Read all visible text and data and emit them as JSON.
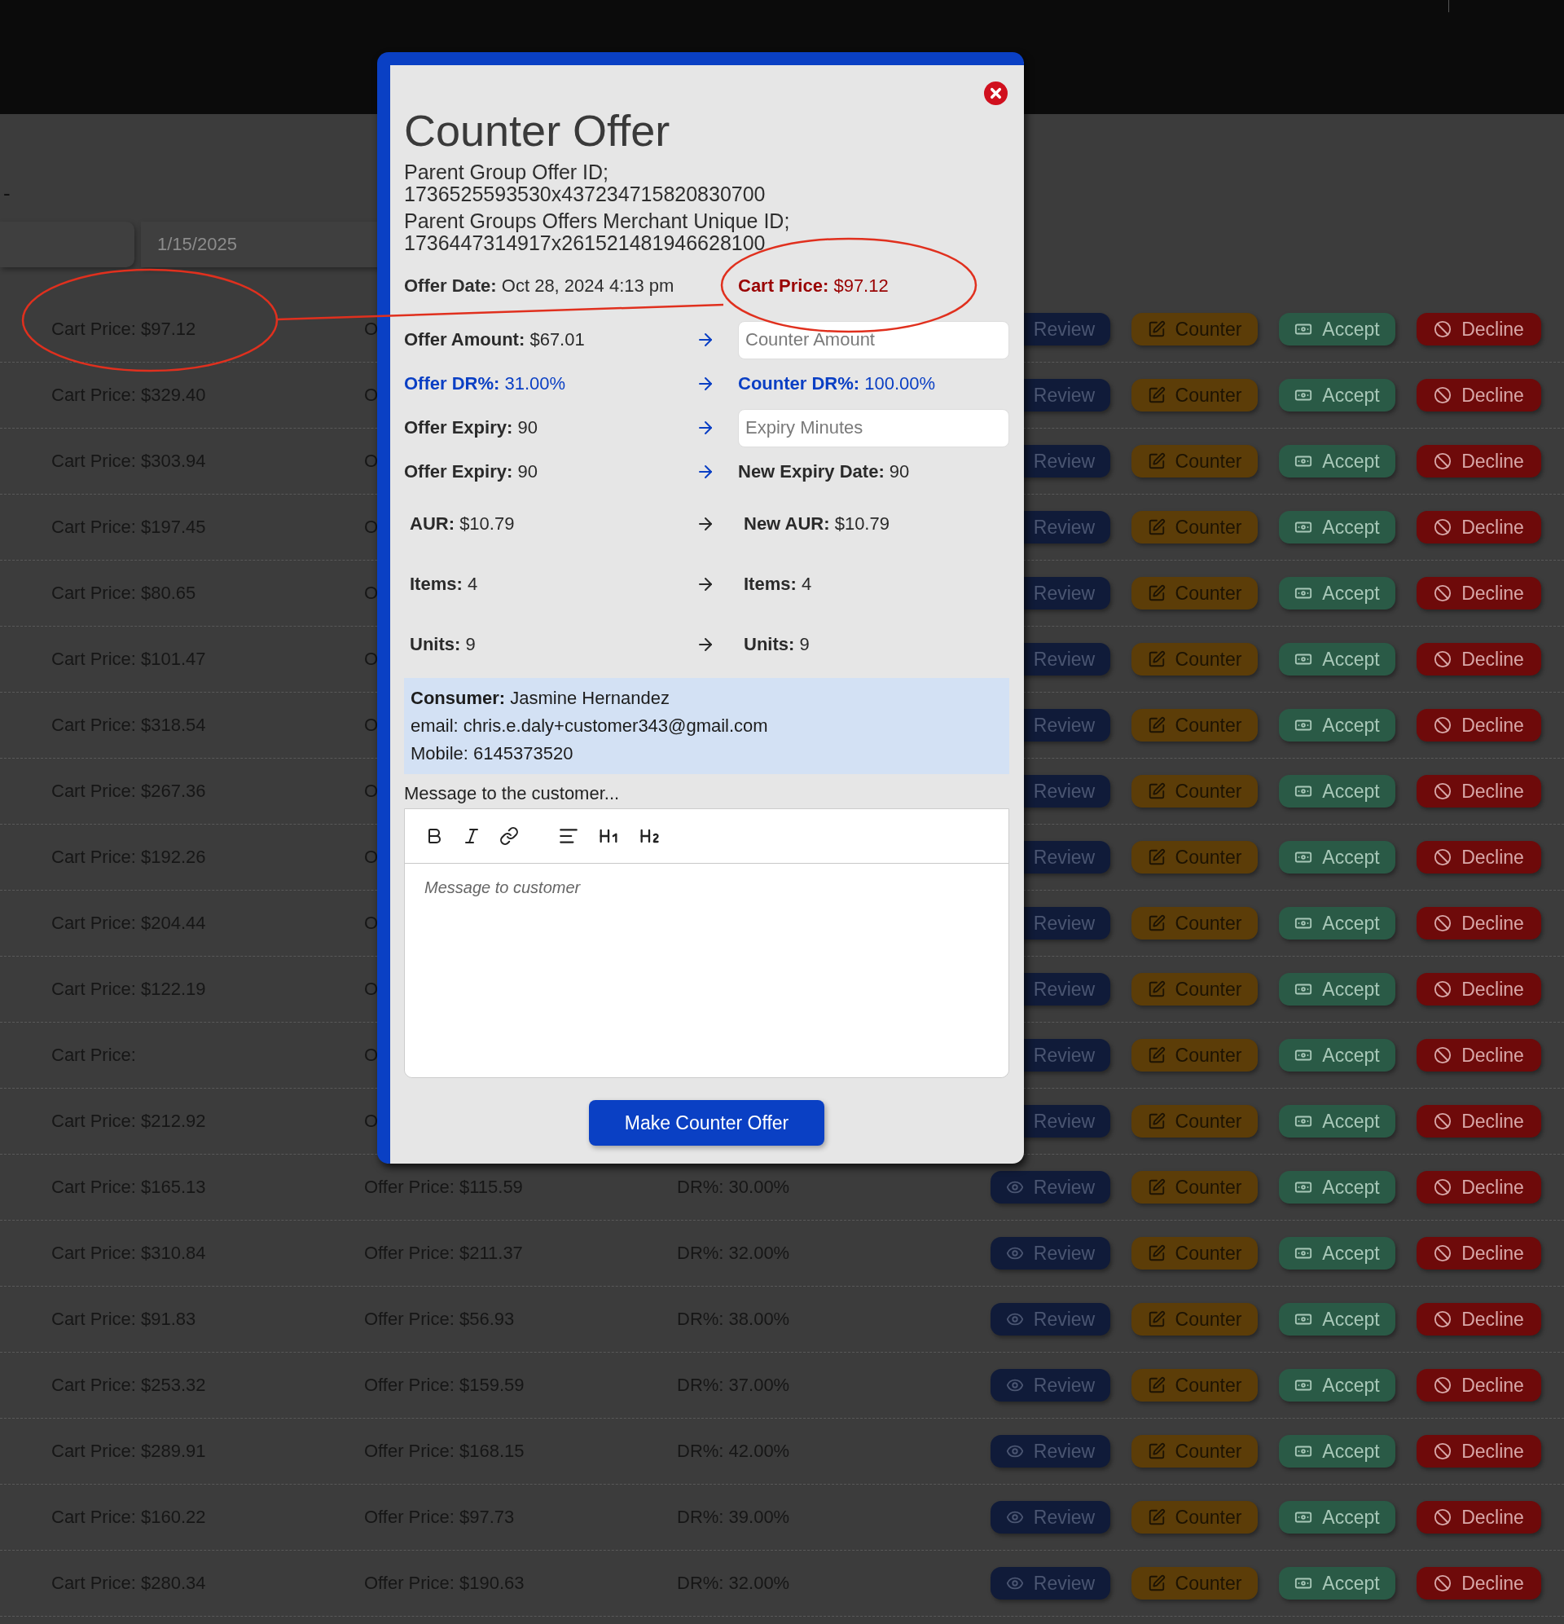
{
  "filters": {
    "separator": "-",
    "end_date": "1/15/2025"
  },
  "rows": [
    {
      "cart_price": "Cart Price: $97.12",
      "offer_price": "O",
      "actions": [
        {
          "kind": "review",
          "label": "Review"
        },
        {
          "kind": "counter",
          "label": "Counter"
        },
        {
          "kind": "accept",
          "label": "Accept"
        },
        {
          "kind": "decline",
          "label": "Decline"
        }
      ]
    },
    {
      "cart_price": "Cart Price: $329.40",
      "offer_price": "O",
      "actions": [
        {
          "kind": "review",
          "label": "Review"
        },
        {
          "kind": "counter",
          "label": "Counter"
        },
        {
          "kind": "accept",
          "label": "Accept"
        },
        {
          "kind": "decline",
          "label": "Decline"
        }
      ]
    },
    {
      "cart_price": "Cart Price: $303.94",
      "offer_price": "O",
      "actions": [
        {
          "kind": "review",
          "label": "Review"
        },
        {
          "kind": "counter",
          "label": "Counter"
        },
        {
          "kind": "accept",
          "label": "Accept"
        },
        {
          "kind": "decline",
          "label": "Decline"
        }
      ]
    },
    {
      "cart_price": "Cart Price: $197.45",
      "offer_price": "O",
      "actions": [
        {
          "kind": "review",
          "label": "Review"
        },
        {
          "kind": "counter",
          "label": "Counter"
        },
        {
          "kind": "accept",
          "label": "Accept"
        },
        {
          "kind": "decline",
          "label": "Decline"
        }
      ]
    },
    {
      "cart_price": "Cart Price: $80.65",
      "offer_price": "O",
      "actions": [
        {
          "kind": "review",
          "label": "Review"
        },
        {
          "kind": "counter",
          "label": "Counter"
        },
        {
          "kind": "accept",
          "label": "Accept"
        },
        {
          "kind": "decline",
          "label": "Decline"
        }
      ]
    },
    {
      "cart_price": "Cart Price: $101.47",
      "offer_price": "O",
      "actions": [
        {
          "kind": "review",
          "label": "Review"
        },
        {
          "kind": "counter",
          "label": "Counter"
        },
        {
          "kind": "accept",
          "label": "Accept"
        },
        {
          "kind": "decline",
          "label": "Decline"
        }
      ]
    },
    {
      "cart_price": "Cart Price: $318.54",
      "offer_price": "O",
      "actions": [
        {
          "kind": "review",
          "label": "Review"
        },
        {
          "kind": "counter",
          "label": "Counter"
        },
        {
          "kind": "accept",
          "label": "Accept"
        },
        {
          "kind": "decline",
          "label": "Decline"
        }
      ]
    },
    {
      "cart_price": "Cart Price: $267.36",
      "offer_price": "O",
      "actions": [
        {
          "kind": "review",
          "label": "Review"
        },
        {
          "kind": "counter",
          "label": "Counter"
        },
        {
          "kind": "accept",
          "label": "Accept"
        },
        {
          "kind": "decline",
          "label": "Decline"
        }
      ]
    },
    {
      "cart_price": "Cart Price: $192.26",
      "offer_price": "O",
      "actions": [
        {
          "kind": "review",
          "label": "Review"
        },
        {
          "kind": "counter",
          "label": "Counter"
        },
        {
          "kind": "accept",
          "label": "Accept"
        },
        {
          "kind": "decline",
          "label": "Decline"
        }
      ]
    },
    {
      "cart_price": "Cart Price: $204.44",
      "offer_price": "O",
      "actions": [
        {
          "kind": "review",
          "label": "Review"
        },
        {
          "kind": "counter",
          "label": "Counter"
        },
        {
          "kind": "accept",
          "label": "Accept"
        },
        {
          "kind": "decline",
          "label": "Decline"
        }
      ]
    },
    {
      "cart_price": "Cart Price: $122.19",
      "offer_price": "O",
      "actions": [
        {
          "kind": "review",
          "label": "Review"
        },
        {
          "kind": "counter",
          "label": "Counter"
        },
        {
          "kind": "accept",
          "label": "Accept"
        },
        {
          "kind": "decline",
          "label": "Decline"
        }
      ]
    },
    {
      "cart_price": "Cart Price:",
      "offer_price": "O",
      "actions": [
        {
          "kind": "review",
          "label": "Review"
        },
        {
          "kind": "counter",
          "label": "Counter"
        },
        {
          "kind": "accept",
          "label": "Accept"
        },
        {
          "kind": "decline",
          "label": "Decline"
        }
      ]
    },
    {
      "cart_price": "Cart Price: $212.92",
      "offer_price": "O",
      "actions": [
        {
          "kind": "review",
          "label": "Review"
        },
        {
          "kind": "counter",
          "label": "Counter"
        },
        {
          "kind": "accept",
          "label": "Accept"
        },
        {
          "kind": "decline",
          "label": "Decline"
        }
      ]
    },
    {
      "cart_price": "Cart Price: $165.13",
      "offer_price": "Offer Price: $115.59",
      "dr": "DR%: 30.00%",
      "actions": [
        {
          "kind": "review",
          "label": "Review"
        },
        {
          "kind": "counter",
          "label": "Counter"
        },
        {
          "kind": "accept",
          "label": "Accept"
        },
        {
          "kind": "decline",
          "label": "Decline"
        }
      ]
    },
    {
      "cart_price": "Cart Price: $310.84",
      "offer_price": "Offer Price: $211.37",
      "dr": "DR%: 32.00%",
      "actions": [
        {
          "kind": "review",
          "label": "Review"
        },
        {
          "kind": "counter",
          "label": "Counter"
        },
        {
          "kind": "accept",
          "label": "Accept"
        },
        {
          "kind": "decline",
          "label": "Decline"
        }
      ]
    },
    {
      "cart_price": "Cart Price: $91.83",
      "offer_price": "Offer Price: $56.93",
      "dr": "DR%: 38.00%",
      "actions": [
        {
          "kind": "review",
          "label": "Review"
        },
        {
          "kind": "counter",
          "label": "Counter"
        },
        {
          "kind": "accept",
          "label": "Accept"
        },
        {
          "kind": "decline",
          "label": "Decline"
        }
      ]
    },
    {
      "cart_price": "Cart Price: $253.32",
      "offer_price": "Offer Price: $159.59",
      "dr": "DR%: 37.00%",
      "actions": [
        {
          "kind": "review",
          "label": "Review"
        },
        {
          "kind": "counter",
          "label": "Counter"
        },
        {
          "kind": "accept",
          "label": "Accept"
        },
        {
          "kind": "decline",
          "label": "Decline"
        }
      ]
    },
    {
      "cart_price": "Cart Price: $289.91",
      "offer_price": "Offer Price: $168.15",
      "dr": "DR%: 42.00%",
      "actions": [
        {
          "kind": "review",
          "label": "Review"
        },
        {
          "kind": "counter",
          "label": "Counter"
        },
        {
          "kind": "accept",
          "label": "Accept"
        },
        {
          "kind": "decline",
          "label": "Decline"
        }
      ]
    },
    {
      "cart_price": "Cart Price: $160.22",
      "offer_price": "Offer Price: $97.73",
      "dr": "DR%: 39.00%",
      "actions": [
        {
          "kind": "review",
          "label": "Review"
        },
        {
          "kind": "counter",
          "label": "Counter"
        },
        {
          "kind": "accept",
          "label": "Accept"
        },
        {
          "kind": "decline",
          "label": "Decline"
        }
      ]
    },
    {
      "cart_price": "Cart Price: $280.34",
      "offer_price": "Offer Price: $190.63",
      "dr": "DR%: 32.00%",
      "actions": [
        {
          "kind": "review",
          "label": "Review"
        },
        {
          "kind": "counter",
          "label": "Counter"
        },
        {
          "kind": "accept",
          "label": "Accept"
        },
        {
          "kind": "decline",
          "label": "Decline"
        }
      ]
    }
  ],
  "modal": {
    "title": "Counter Offer",
    "ids": [
      {
        "label": "Parent Group Offer ID;",
        "value": "1736525593530x437234715820830700"
      },
      {
        "label": "Parent Groups Offers Merchant Unique ID;",
        "value": "1736447314917x261521481946628100"
      }
    ],
    "offer_date": {
      "label": "Offer Date:",
      "value": "Oct 28, 2024 4:13 pm"
    },
    "cart_price": {
      "label": "Cart Price:",
      "value": "$97.12"
    },
    "comparisons": [
      {
        "color": "#2a2a2a",
        "left": {
          "label": "Offer Amount:",
          "value": "$67.01"
        },
        "right": {
          "kind": "input",
          "placeholder": "Counter Amount"
        }
      },
      {
        "color": "#0a3fc4",
        "left": {
          "label": "Offer DR%:",
          "value": "31.00%"
        },
        "right": {
          "kind": "text",
          "label": "Counter DR%:",
          "value": "100.00%"
        }
      },
      {
        "color": "#2a2a2a",
        "left": {
          "label": "Offer Expiry:",
          "value": "90"
        },
        "right": {
          "kind": "input",
          "placeholder": "Expiry Minutes"
        }
      },
      {
        "color": "#2a2a2a",
        "left": {
          "label": "Offer Expiry:",
          "value": "90"
        },
        "right": {
          "kind": "text",
          "label": "New Expiry Date:",
          "value": "90"
        }
      }
    ],
    "stats": [
      {
        "left": {
          "label": "AUR:",
          "value": "$10.79"
        },
        "right": {
          "label": "New AUR:",
          "value": "$10.79"
        }
      },
      {
        "left": {
          "label": "Items:",
          "value": "4"
        },
        "right": {
          "label": "Items:",
          "value": "4"
        }
      },
      {
        "left": {
          "label": "Units:",
          "value": "9"
        },
        "right": {
          "label": "Units:",
          "value": "9"
        }
      }
    ],
    "consumer": {
      "label": "Consumer:",
      "name": "Jasmine Hernandez",
      "email": "email: chris.e.daly+customer343@gmail.com",
      "mobile": "Mobile: 6145373520"
    },
    "message_label": "Message to the customer...",
    "message_placeholder": "Message to customer",
    "submit": "Make Counter Offer"
  }
}
